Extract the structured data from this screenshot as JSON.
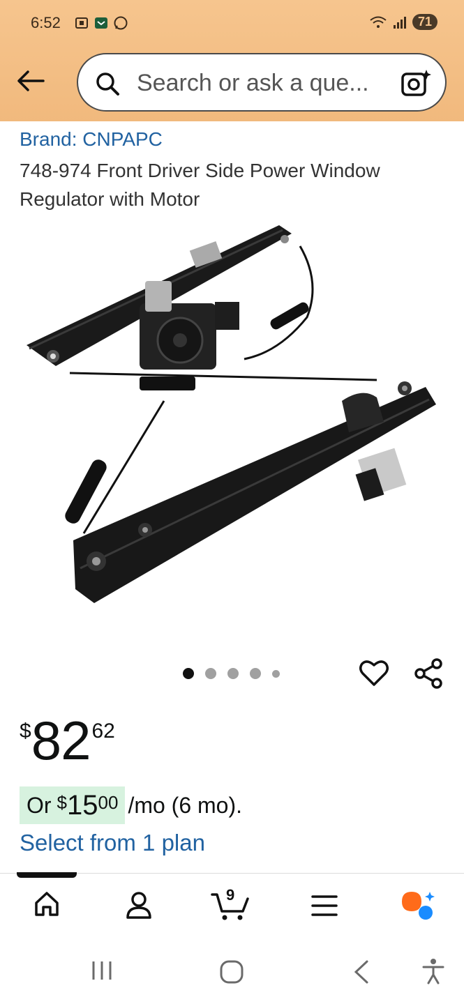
{
  "status_bar": {
    "time": "6:52",
    "battery": "71",
    "icons": [
      "screenshot-icon",
      "app-icon",
      "whatsapp-icon",
      "wifi-icon",
      "signal-icon"
    ]
  },
  "header": {
    "search_placeholder": "Search or ask a que...",
    "accent": "#f1b97d"
  },
  "product": {
    "brand": "Brand: CNPAPC",
    "title": "748-974 Front Driver Side Power Window Regulator with Motor",
    "image_alt": "window regulator with motor",
    "image_count": 5,
    "active_image": 1
  },
  "price": {
    "symbol": "$",
    "whole": "82",
    "fraction": "62"
  },
  "installment": {
    "prefix": "Or",
    "symbol": "$",
    "whole": "15",
    "fraction": "00",
    "suffix": "/mo (6 mo).",
    "highlight": "#d7f2df"
  },
  "plan_link": "Select from 1 plan",
  "bottom_nav": {
    "items": [
      "home-icon",
      "account-icon",
      "cart-icon",
      "menu-icon",
      "ai-assistant-icon"
    ],
    "cart_count": "9"
  },
  "system_nav": [
    "recents-icon",
    "home-button-icon",
    "back-icon",
    "accessibility-icon"
  ],
  "colors": {
    "link": "#2162a1",
    "text": "#0f1111"
  }
}
